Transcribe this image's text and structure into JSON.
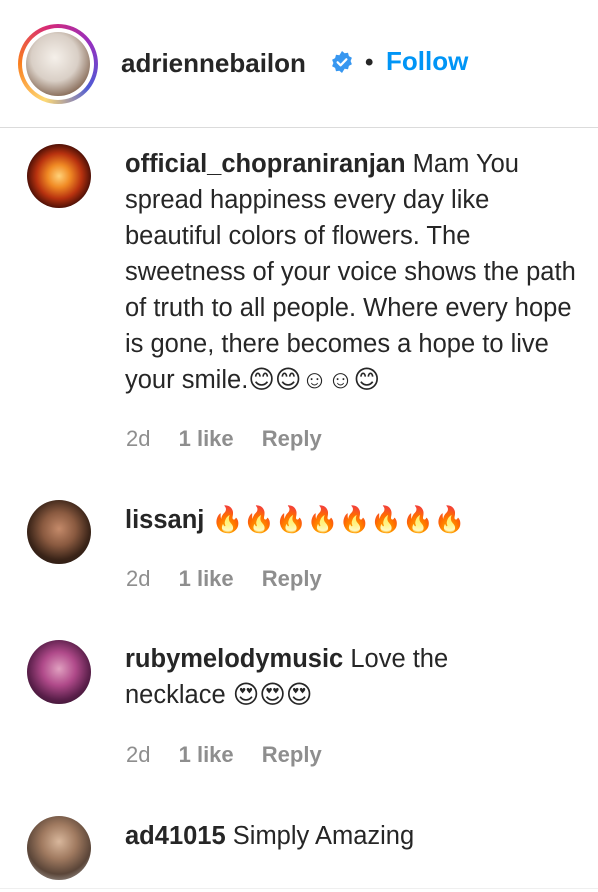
{
  "post_header": {
    "username": "adriennebailon",
    "verified_icon": "verified-badge-icon",
    "separator": "•",
    "follow_label": "Follow",
    "accent_color": "#0095f6"
  },
  "comments": [
    {
      "username": "official_chopraniranjan",
      "text": "Mam You spread happiness every day like beautiful colors of flowers. The sweetness of your voice shows the path of truth to all people. Where every hope is gone, there becomes a hope to live your smile.😊😊☺☺😊",
      "time": "2d",
      "likes": "1 like",
      "reply_label": "Reply"
    },
    {
      "username": "lissanj",
      "text": "🔥🔥🔥🔥🔥🔥🔥🔥",
      "time": "2d",
      "likes": "1 like",
      "reply_label": "Reply"
    },
    {
      "username": "rubymelodymusic",
      "text": "Love the necklace 😍😍😍",
      "time": "2d",
      "likes": "1 like",
      "reply_label": "Reply"
    },
    {
      "username": "ad41015",
      "text": "Simply Amazing"
    }
  ]
}
